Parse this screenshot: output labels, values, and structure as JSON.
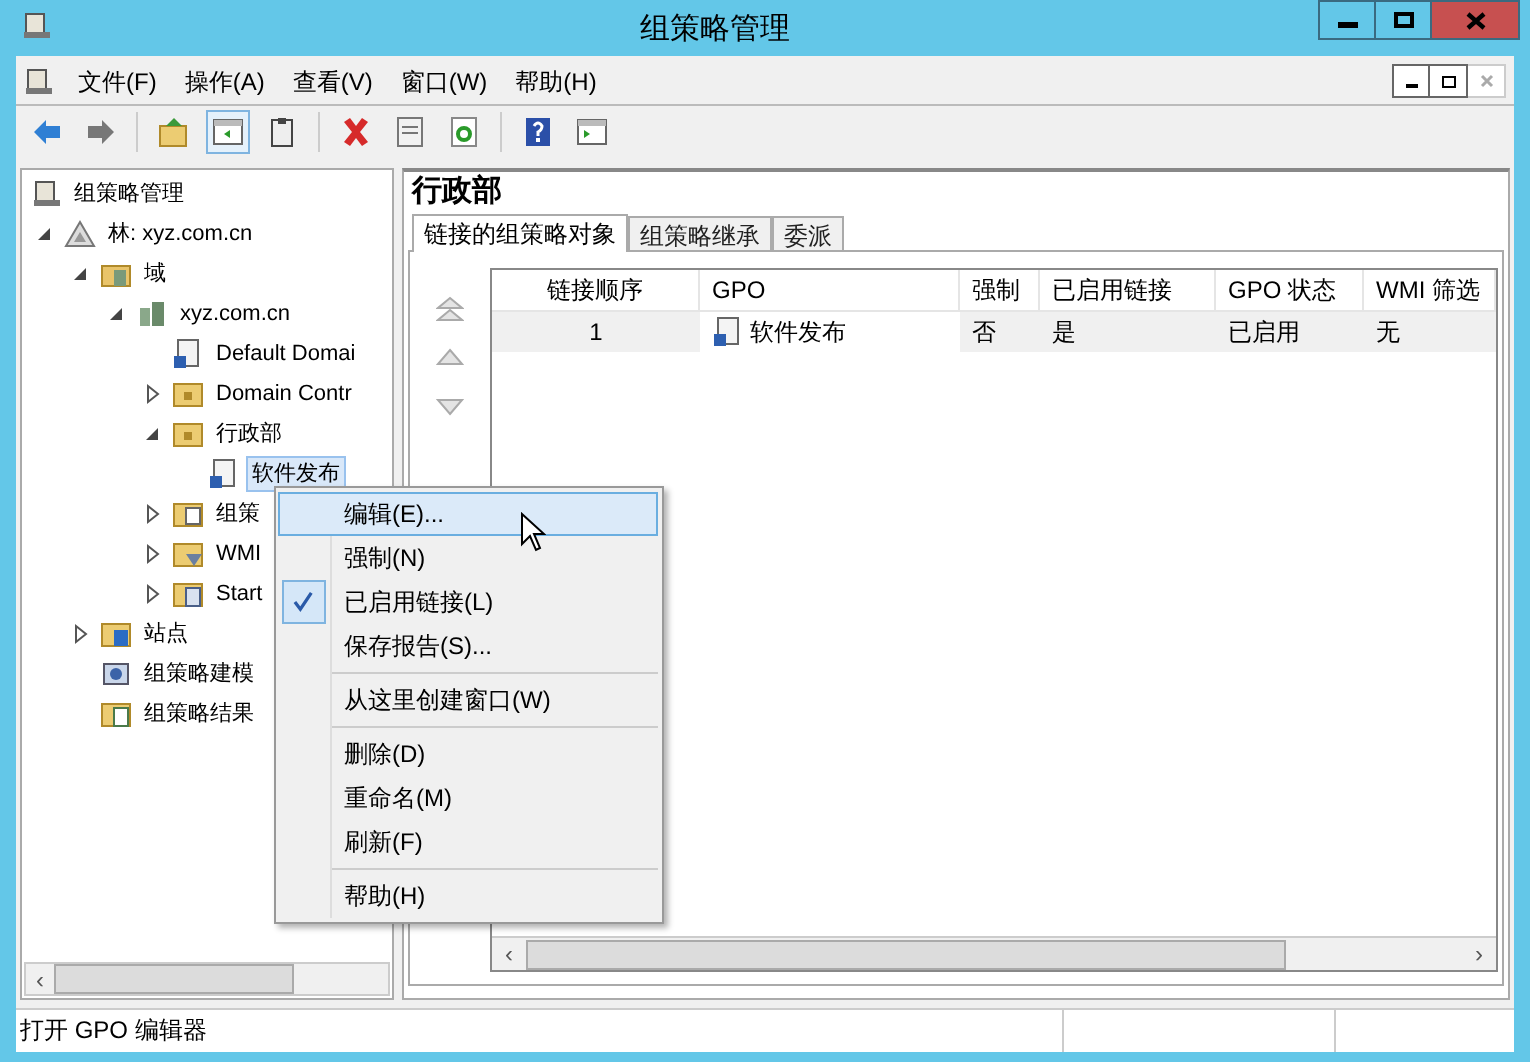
{
  "window": {
    "title": "组策略管理"
  },
  "scroll_arrows": {
    "left": "‹",
    "right": "›"
  },
  "menu_bar": [
    {
      "label": "文件(F)"
    },
    {
      "label": "操作(A)"
    },
    {
      "label": "查看(V)"
    },
    {
      "label": "窗口(W)"
    },
    {
      "label": "帮助(H)"
    }
  ],
  "toolbar": [
    {
      "kind": "back"
    },
    {
      "kind": "forward"
    },
    {
      "kind": "sep"
    },
    {
      "kind": "up"
    },
    {
      "kind": "pane",
      "selected": true
    },
    {
      "kind": "clipboard"
    },
    {
      "kind": "sep"
    },
    {
      "kind": "delete"
    },
    {
      "kind": "properties"
    },
    {
      "kind": "refresh"
    },
    {
      "kind": "sep"
    },
    {
      "kind": "help"
    },
    {
      "kind": "action-pane"
    }
  ],
  "tree": [
    {
      "label": "组策略管理",
      "kind": "console",
      "selected": false,
      "children": [
        {
          "label": "林: xyz.com.cn",
          "kind": "forest",
          "expanded": true,
          "selected": false,
          "children": [
            {
              "label": "域",
              "kind": "domains",
              "expanded": true,
              "selected": false,
              "children": [
                {
                  "label": "xyz.com.cn",
                  "kind": "domain",
                  "expanded": true,
                  "selected": false,
                  "children": [
                    {
                      "label": "Default Domai",
                      "kind": "gpo",
                      "selected": false
                    },
                    {
                      "label": "Domain Contr",
                      "kind": "ou",
                      "expanded": false,
                      "selected": false
                    },
                    {
                      "label": "行政部",
                      "kind": "ou",
                      "expanded": true,
                      "selected": false,
                      "children": [
                        {
                          "label": "软件发布",
                          "kind": "gpo",
                          "selected": true
                        }
                      ]
                    },
                    {
                      "label": "组策",
                      "kind": "gpo-folder",
                      "expanded": false,
                      "selected": false
                    },
                    {
                      "label": "WMI",
                      "kind": "wmi",
                      "expanded": false,
                      "selected": false
                    },
                    {
                      "label": "Start",
                      "kind": "starter",
                      "expanded": false,
                      "selected": false
                    }
                  ]
                }
              ]
            },
            {
              "label": "站点",
              "kind": "sites",
              "expanded": false,
              "selected": false
            },
            {
              "label": "组策略建模",
              "kind": "modeling",
              "selected": false
            },
            {
              "label": "组策略结果",
              "kind": "results",
              "selected": false
            }
          ]
        }
      ]
    }
  ],
  "detail": {
    "title": "行政部",
    "tabs": [
      {
        "label": "链接的组策略对象",
        "selected": true
      },
      {
        "label": "组策略继承",
        "selected": false
      },
      {
        "label": "委派",
        "selected": false
      }
    ],
    "table": {
      "columns": [
        "链接顺序",
        "GPO",
        "强制",
        "已启用链接",
        "GPO 状态",
        "WMI 筛选"
      ],
      "rows": [
        {
          "cells": [
            "1",
            "软件发布",
            "否",
            "是",
            "已启用",
            "无"
          ]
        }
      ]
    }
  },
  "context_menu": [
    {
      "kind": "item",
      "label": "编辑(E)...",
      "selected": true
    },
    {
      "kind": "item",
      "label": "强制(N)",
      "selected": false,
      "checked": false
    },
    {
      "kind": "item",
      "label": "已启用链接(L)",
      "selected": false,
      "checked": true
    },
    {
      "kind": "item",
      "label": "保存报告(S)...",
      "selected": false
    },
    {
      "kind": "separator"
    },
    {
      "kind": "item",
      "label": "从这里创建窗口(W)",
      "selected": false
    },
    {
      "kind": "separator"
    },
    {
      "kind": "item",
      "label": "删除(D)",
      "selected": false
    },
    {
      "kind": "item",
      "label": "重命名(M)",
      "selected": false
    },
    {
      "kind": "item",
      "label": "刷新(F)",
      "selected": false
    },
    {
      "kind": "separator"
    },
    {
      "kind": "item",
      "label": "帮助(H)",
      "selected": false
    }
  ],
  "status_bar": {
    "text": "打开 GPO 编辑器"
  }
}
